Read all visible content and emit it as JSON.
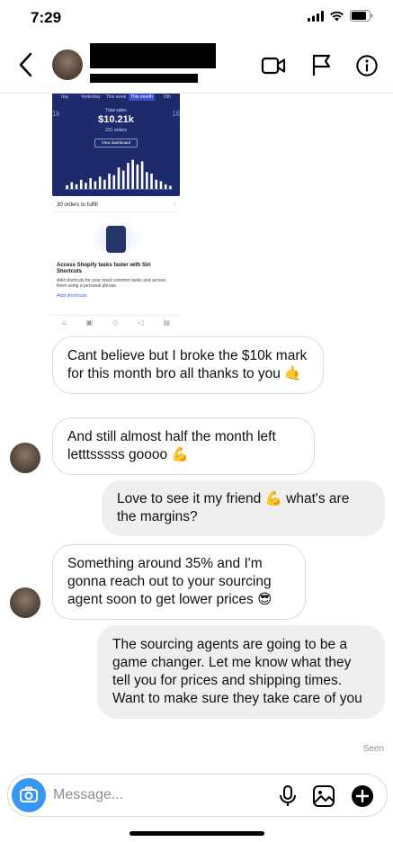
{
  "status_bar": {
    "time": "7:29"
  },
  "header": {
    "back_icon": "chevron-left-icon",
    "video_icon": "video-call-icon",
    "flag_icon": "flag-icon",
    "info_icon": "info-icon"
  },
  "shared_screenshot": {
    "tabs": [
      "day",
      "Yesterday",
      "This week",
      "This month",
      "Oth"
    ],
    "total_sales_label": "Total sales",
    "total_sales_value": "$10.21k",
    "orders": "231 orders",
    "view_dashboard": "View dashboard",
    "side_left": "1k",
    "side_right": "16",
    "bar_levels": [
      0.12,
      0.22,
      0.15,
      0.3,
      0.2,
      0.35,
      0.25,
      0.4,
      0.3,
      0.5,
      0.45,
      0.7,
      0.6,
      0.85,
      0.95,
      0.8,
      0.9,
      0.55,
      0.5,
      0.3,
      0.25,
      0.15,
      0.1
    ],
    "fulfill_text": "30 orders to fulfill",
    "siri_title": "Access Shopify tasks faster with Siri Shortcuts",
    "siri_desc": "Add shortcuts for your most common tasks and access them using a personal phrase.",
    "siri_link": "Add shortcuts"
  },
  "messages": [
    {
      "from": "them",
      "text": "Cant believe but I broke the $10k mark for this month bro all thanks to you 🤙"
    },
    {
      "from": "them",
      "text": "And still almost half the month left letttsssss goooo 💪"
    },
    {
      "from": "me",
      "text": "Love to see it my friend 💪 what's are the margins?"
    },
    {
      "from": "them",
      "text": "Something around 35% and I'm gonna reach out to your sourcing agent soon to get lower prices 😎"
    },
    {
      "from": "me",
      "text": "The sourcing agents are going to be a game changer. Let me know what they tell you for prices and shipping times. Want to make sure they take care of you"
    }
  ],
  "seen_label": "Seen",
  "composer": {
    "placeholder": "Message...",
    "camera_icon": "camera-icon",
    "mic_icon": "microphone-icon",
    "gallery_icon": "gallery-icon",
    "add_icon": "plus-circle-icon"
  }
}
